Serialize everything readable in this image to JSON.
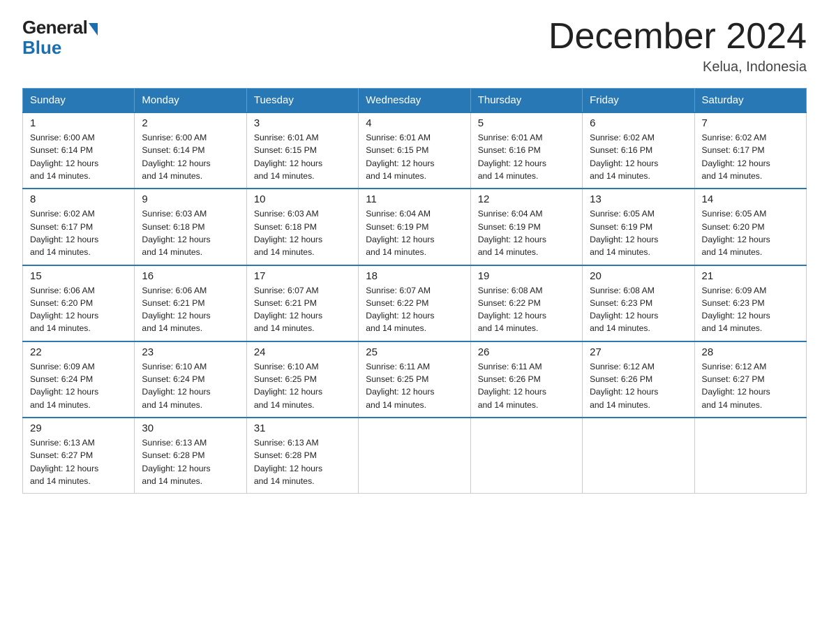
{
  "header": {
    "logo_general": "General",
    "logo_blue": "Blue",
    "month_title": "December 2024",
    "location": "Kelua, Indonesia"
  },
  "days_of_week": [
    "Sunday",
    "Monday",
    "Tuesday",
    "Wednesday",
    "Thursday",
    "Friday",
    "Saturday"
  ],
  "weeks": [
    [
      {
        "day": "1",
        "sunrise": "6:00 AM",
        "sunset": "6:14 PM",
        "daylight": "12 hours and 14 minutes."
      },
      {
        "day": "2",
        "sunrise": "6:00 AM",
        "sunset": "6:14 PM",
        "daylight": "12 hours and 14 minutes."
      },
      {
        "day": "3",
        "sunrise": "6:01 AM",
        "sunset": "6:15 PM",
        "daylight": "12 hours and 14 minutes."
      },
      {
        "day": "4",
        "sunrise": "6:01 AM",
        "sunset": "6:15 PM",
        "daylight": "12 hours and 14 minutes."
      },
      {
        "day": "5",
        "sunrise": "6:01 AM",
        "sunset": "6:16 PM",
        "daylight": "12 hours and 14 minutes."
      },
      {
        "day": "6",
        "sunrise": "6:02 AM",
        "sunset": "6:16 PM",
        "daylight": "12 hours and 14 minutes."
      },
      {
        "day": "7",
        "sunrise": "6:02 AM",
        "sunset": "6:17 PM",
        "daylight": "12 hours and 14 minutes."
      }
    ],
    [
      {
        "day": "8",
        "sunrise": "6:02 AM",
        "sunset": "6:17 PM",
        "daylight": "12 hours and 14 minutes."
      },
      {
        "day": "9",
        "sunrise": "6:03 AM",
        "sunset": "6:18 PM",
        "daylight": "12 hours and 14 minutes."
      },
      {
        "day": "10",
        "sunrise": "6:03 AM",
        "sunset": "6:18 PM",
        "daylight": "12 hours and 14 minutes."
      },
      {
        "day": "11",
        "sunrise": "6:04 AM",
        "sunset": "6:19 PM",
        "daylight": "12 hours and 14 minutes."
      },
      {
        "day": "12",
        "sunrise": "6:04 AM",
        "sunset": "6:19 PM",
        "daylight": "12 hours and 14 minutes."
      },
      {
        "day": "13",
        "sunrise": "6:05 AM",
        "sunset": "6:19 PM",
        "daylight": "12 hours and 14 minutes."
      },
      {
        "day": "14",
        "sunrise": "6:05 AM",
        "sunset": "6:20 PM",
        "daylight": "12 hours and 14 minutes."
      }
    ],
    [
      {
        "day": "15",
        "sunrise": "6:06 AM",
        "sunset": "6:20 PM",
        "daylight": "12 hours and 14 minutes."
      },
      {
        "day": "16",
        "sunrise": "6:06 AM",
        "sunset": "6:21 PM",
        "daylight": "12 hours and 14 minutes."
      },
      {
        "day": "17",
        "sunrise": "6:07 AM",
        "sunset": "6:21 PM",
        "daylight": "12 hours and 14 minutes."
      },
      {
        "day": "18",
        "sunrise": "6:07 AM",
        "sunset": "6:22 PM",
        "daylight": "12 hours and 14 minutes."
      },
      {
        "day": "19",
        "sunrise": "6:08 AM",
        "sunset": "6:22 PM",
        "daylight": "12 hours and 14 minutes."
      },
      {
        "day": "20",
        "sunrise": "6:08 AM",
        "sunset": "6:23 PM",
        "daylight": "12 hours and 14 minutes."
      },
      {
        "day": "21",
        "sunrise": "6:09 AM",
        "sunset": "6:23 PM",
        "daylight": "12 hours and 14 minutes."
      }
    ],
    [
      {
        "day": "22",
        "sunrise": "6:09 AM",
        "sunset": "6:24 PM",
        "daylight": "12 hours and 14 minutes."
      },
      {
        "day": "23",
        "sunrise": "6:10 AM",
        "sunset": "6:24 PM",
        "daylight": "12 hours and 14 minutes."
      },
      {
        "day": "24",
        "sunrise": "6:10 AM",
        "sunset": "6:25 PM",
        "daylight": "12 hours and 14 minutes."
      },
      {
        "day": "25",
        "sunrise": "6:11 AM",
        "sunset": "6:25 PM",
        "daylight": "12 hours and 14 minutes."
      },
      {
        "day": "26",
        "sunrise": "6:11 AM",
        "sunset": "6:26 PM",
        "daylight": "12 hours and 14 minutes."
      },
      {
        "day": "27",
        "sunrise": "6:12 AM",
        "sunset": "6:26 PM",
        "daylight": "12 hours and 14 minutes."
      },
      {
        "day": "28",
        "sunrise": "6:12 AM",
        "sunset": "6:27 PM",
        "daylight": "12 hours and 14 minutes."
      }
    ],
    [
      {
        "day": "29",
        "sunrise": "6:13 AM",
        "sunset": "6:27 PM",
        "daylight": "12 hours and 14 minutes."
      },
      {
        "day": "30",
        "sunrise": "6:13 AM",
        "sunset": "6:28 PM",
        "daylight": "12 hours and 14 minutes."
      },
      {
        "day": "31",
        "sunrise": "6:13 AM",
        "sunset": "6:28 PM",
        "daylight": "12 hours and 14 minutes."
      },
      null,
      null,
      null,
      null
    ]
  ],
  "labels": {
    "sunrise_prefix": "Sunrise: ",
    "sunset_prefix": "Sunset: ",
    "daylight_prefix": "Daylight: "
  }
}
